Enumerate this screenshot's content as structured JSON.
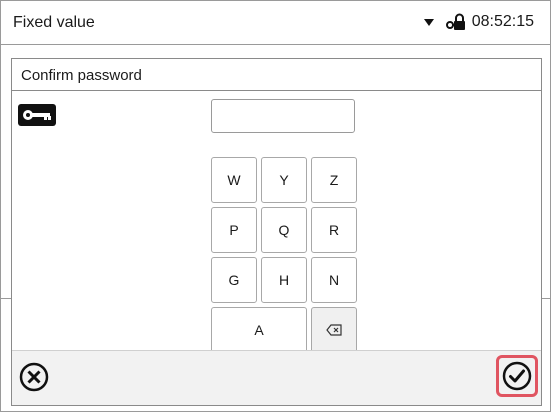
{
  "status_bar": {
    "mode_label": "Fixed value",
    "time": "08:52:15",
    "dropdown_icon": "chevron-down-icon",
    "lock_icon": "lock-key-icon"
  },
  "dialog": {
    "title": "Confirm password",
    "key_icon": "key-icon",
    "password_value": "",
    "keypad": {
      "row1": [
        "W",
        "Y",
        "Z"
      ],
      "row2": [
        "P",
        "Q",
        "R"
      ],
      "row3": [
        "G",
        "H",
        "N"
      ],
      "row4_wide": "A",
      "backspace_icon": "backspace-icon"
    },
    "cancel_icon": "close-circle-icon",
    "confirm_icon": "check-circle-icon",
    "confirm_highlight_color": "#e05561"
  }
}
